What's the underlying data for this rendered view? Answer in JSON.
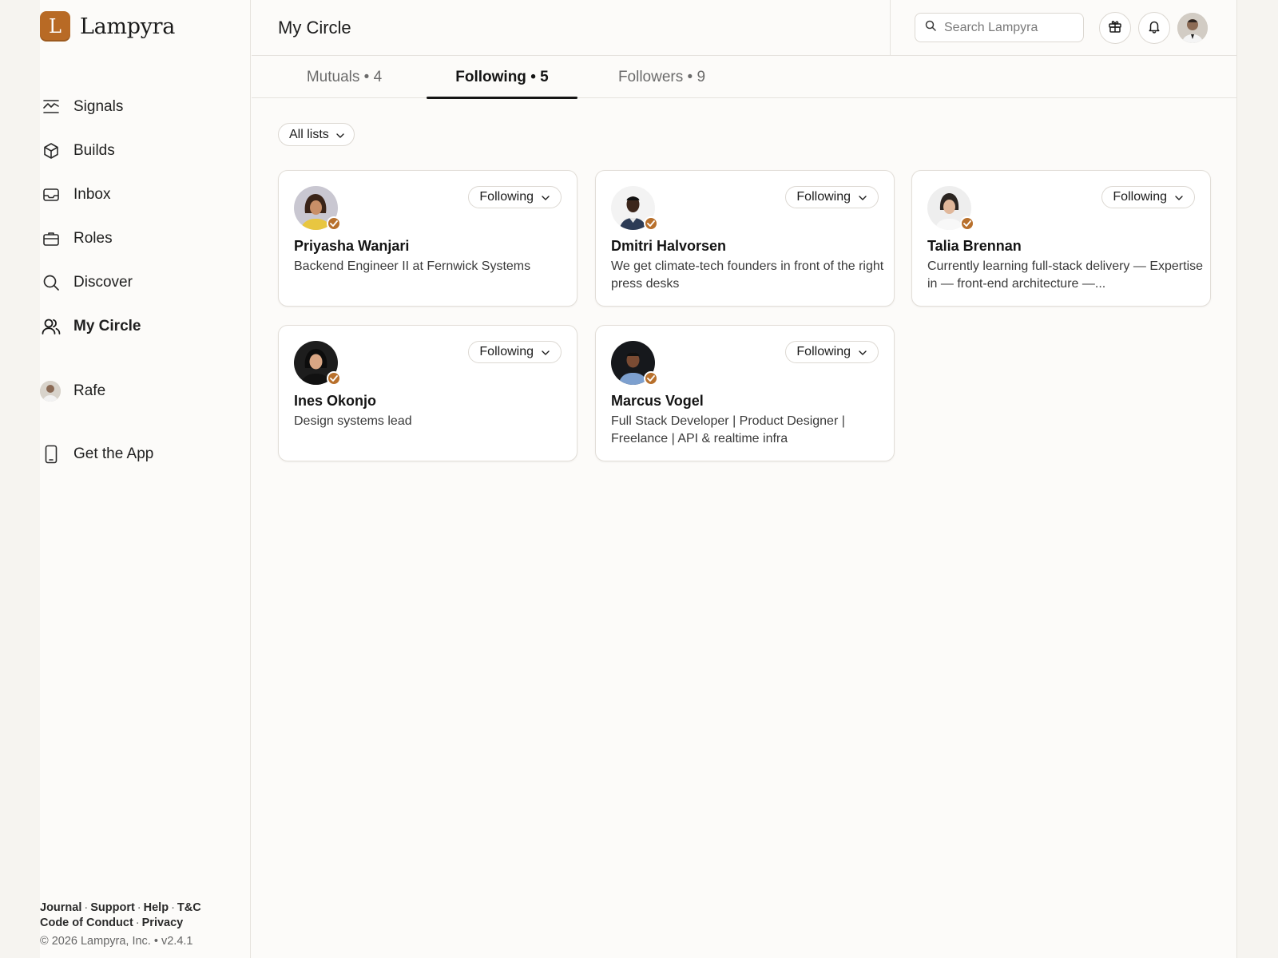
{
  "brand": {
    "name": "Lampyra",
    "initial": "L",
    "accent": "#b86a25"
  },
  "sidebar": {
    "items": [
      {
        "label": "Signals",
        "icon": "signals-icon"
      },
      {
        "label": "Builds",
        "icon": "cube-icon"
      },
      {
        "label": "Inbox",
        "icon": "inbox-icon"
      },
      {
        "label": "Roles",
        "icon": "briefcase-icon"
      },
      {
        "label": "Discover",
        "icon": "search-icon"
      },
      {
        "label": "My Circle",
        "icon": "users-icon",
        "active": true
      }
    ],
    "user": {
      "label": "Rafe"
    },
    "get_app": {
      "label": "Get the App"
    },
    "footer": {
      "links": [
        "Journal",
        "Support",
        "Help",
        "T&C",
        "Code of Conduct",
        "Privacy"
      ],
      "copyright": "© 2026 Lampyra, Inc. • v2.4.1"
    }
  },
  "header": {
    "title": "My Circle",
    "search_placeholder": "Search Lampyra"
  },
  "tabs": [
    {
      "label": "Mutuals",
      "count": "4",
      "active": false
    },
    {
      "label": "Following",
      "count": "5",
      "active": true
    },
    {
      "label": "Followers",
      "count": "9",
      "active": false
    }
  ],
  "filter": {
    "label": "All lists"
  },
  "cards": [
    {
      "name": "Priyasha Wanjari",
      "bio": "Backend Engineer II at Fernwick Systems",
      "button": "Following"
    },
    {
      "name": "Dmitri Halvorsen",
      "bio": "We get climate-tech founders in front of the right press desks",
      "button": "Following"
    },
    {
      "name": "Talia Brennan",
      "bio": "Currently learning full-stack delivery — Expertise in — front-end architecture —...",
      "button": "Following"
    },
    {
      "name": "Ines Okonjo",
      "bio": "Design systems lead",
      "button": "Following"
    },
    {
      "name": "Marcus Vogel",
      "bio": "Full Stack Developer | Product Designer | Freelance | API & realtime infra",
      "button": "Following"
    }
  ]
}
